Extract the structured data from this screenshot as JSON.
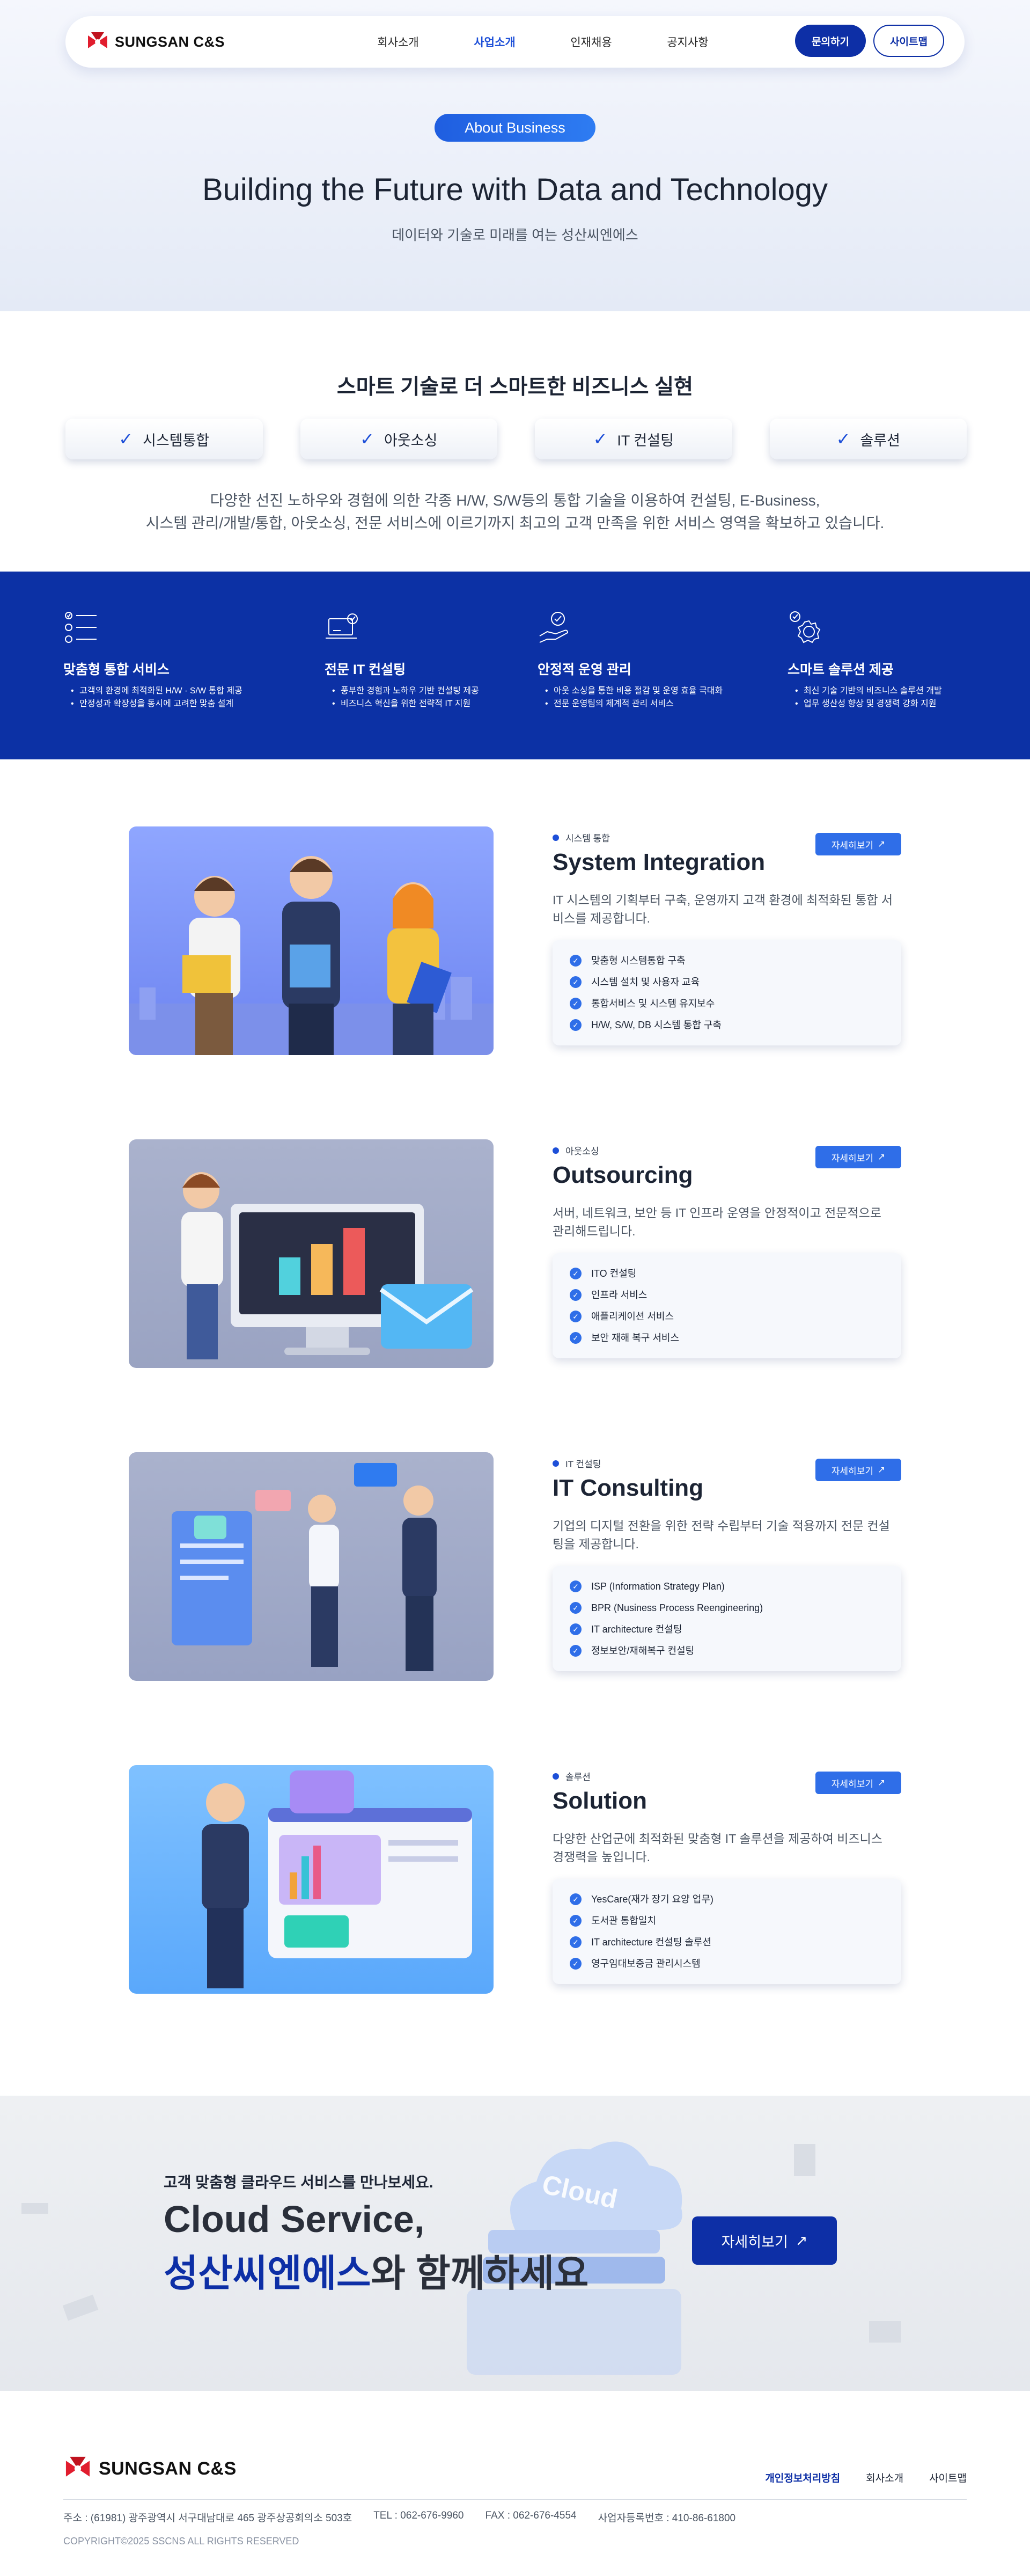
{
  "header": {
    "brand": "SUNGSAN C&S",
    "menu": [
      "회사소개",
      "사업소개",
      "인재채용",
      "공지사항"
    ],
    "active_menu": "사업소개",
    "contact_label": "문의하기",
    "sitemap_label": "사이트맵"
  },
  "hero": {
    "badge": "About Business",
    "title": "Building the Future with Data and Technology",
    "subtitle": "데이터와 기술로 미래를 여는 성산씨엔에스"
  },
  "smart": {
    "title": "스마트 기술로 더 스마트한 비즈니스 실현",
    "chips": [
      "시스템통합",
      "아웃소싱",
      "IT 컨설팅",
      "솔루션"
    ],
    "desc_line1": "다양한 선진 노하우와 경험에 의한 각종 H/W, S/W등의 통합 기술을 이용하여 컨설팅,  E-Business,",
    "desc_line2": "시스템 관리/개발/통합, 아웃소싱, 전문 서비스에 이르기까지 최고의 고객 만족을 위한 서비스 영역을 확보하고 있습니다."
  },
  "features": [
    {
      "icon": "checklist-icon",
      "title": "맞춤형 통합 서비스",
      "items": [
        "고객의 환경에 최적화된 H/W · S/W 통합 제공",
        "안정성과 확장성을 동시에 고려한 맞춤 설계"
      ]
    },
    {
      "icon": "laptop-check-icon",
      "title": "전문 IT 컨설팅",
      "items": [
        "풍부한 경험과 노하우 기반 컨설팅 제공",
        "비즈니스 혁신을 위한 전략적 IT 지원"
      ]
    },
    {
      "icon": "hand-check-icon",
      "title": "안정적 운영 관리",
      "items": [
        "아웃 소싱을 통한 비용 절감 및 운영 효율 극대화",
        "전문 운영팀의 체계적 관리 서비스"
      ]
    },
    {
      "icon": "gear-check-icon",
      "title": "스마트 솔루션 제공",
      "items": [
        "최신 기술 기반의 비즈니스 솔루션 개발",
        "업무 생산성 향상 및 경쟁력 강화 지원"
      ]
    }
  ],
  "more_label": "자세히보기",
  "services": [
    {
      "tag": "시스템 통합",
      "title": "System Integration",
      "desc": "IT 시스템의 기획부터 구축, 운영까지 고객 환경에 최적화된 통합 서비스를 제공합니다.",
      "items": [
        "맞춤형 시스템통합 구축",
        "시스템 설치 및 사용자 교육",
        "통합서비스 및 시스템 유지보수",
        "H/W, S/W, DB 시스템 통합 구축"
      ]
    },
    {
      "tag": "아웃소싱",
      "title": "Outsourcing",
      "desc": "서버, 네트워크, 보안 등 IT 인프라   운영을 안정적이고 전문적으로 관리해드립니다.",
      "items": [
        "ITO 컨설팅",
        "인프라 서비스",
        "애플리케이션 서비스",
        "보안 재해 복구 서비스"
      ]
    },
    {
      "tag": "IT 컨설팅",
      "title": "IT Consulting",
      "desc": "기업의 디지털 전환을 위한 전략 수립부터 기술 적용까지 전문 컨설팅을 제공합니다.",
      "items": [
        "ISP (Information Strategy Plan)",
        "BPR (Nusiness Process Reengineering)",
        "IT architecture 컨설팅",
        "정보보안/재해복구 컨설팅"
      ]
    },
    {
      "tag": "솔루션",
      "title": "Solution",
      "desc": "다양한 산업군에 최적화된 맞춤형 IT 솔루션을 제공하여 비즈니스 경쟁력을 높입니다.",
      "items": [
        "YesCare(재가 장기 요양 업무)",
        "도서관 통합일치",
        "IT architecture 컨설팅 솔루션",
        "영구임대보증금 관리시스템"
      ]
    }
  ],
  "cloud": {
    "sub": "고객 맞춤형 클라우드 서비스를 만나보세요.",
    "title1": "Cloud Service,",
    "title2_highlight": "성산씨엔에스",
    "title2_rest": "와 함께하세요",
    "button": "자세히보기",
    "cloud_word": "Cloud"
  },
  "footer": {
    "brand": "SUNGSAN C&S",
    "links": [
      "개인정보처리방침",
      "회사소개",
      "사이트맵"
    ],
    "address": "주소 : (61981) 광주광역시 서구대남대로 465 광주상공회의소 503호",
    "tel": "TEL : 062-676-9960",
    "fax": "FAX : 062-676-4554",
    "biz": "사업자등록번호 : 410-86-61800",
    "copyright": "COPYRIGHT©2025 SSCNS ALL RIGHTS RESERVED"
  },
  "colors": {
    "primary": "#0d2fa6",
    "accent": "#2f6ee8",
    "band": "#0c31a5"
  }
}
